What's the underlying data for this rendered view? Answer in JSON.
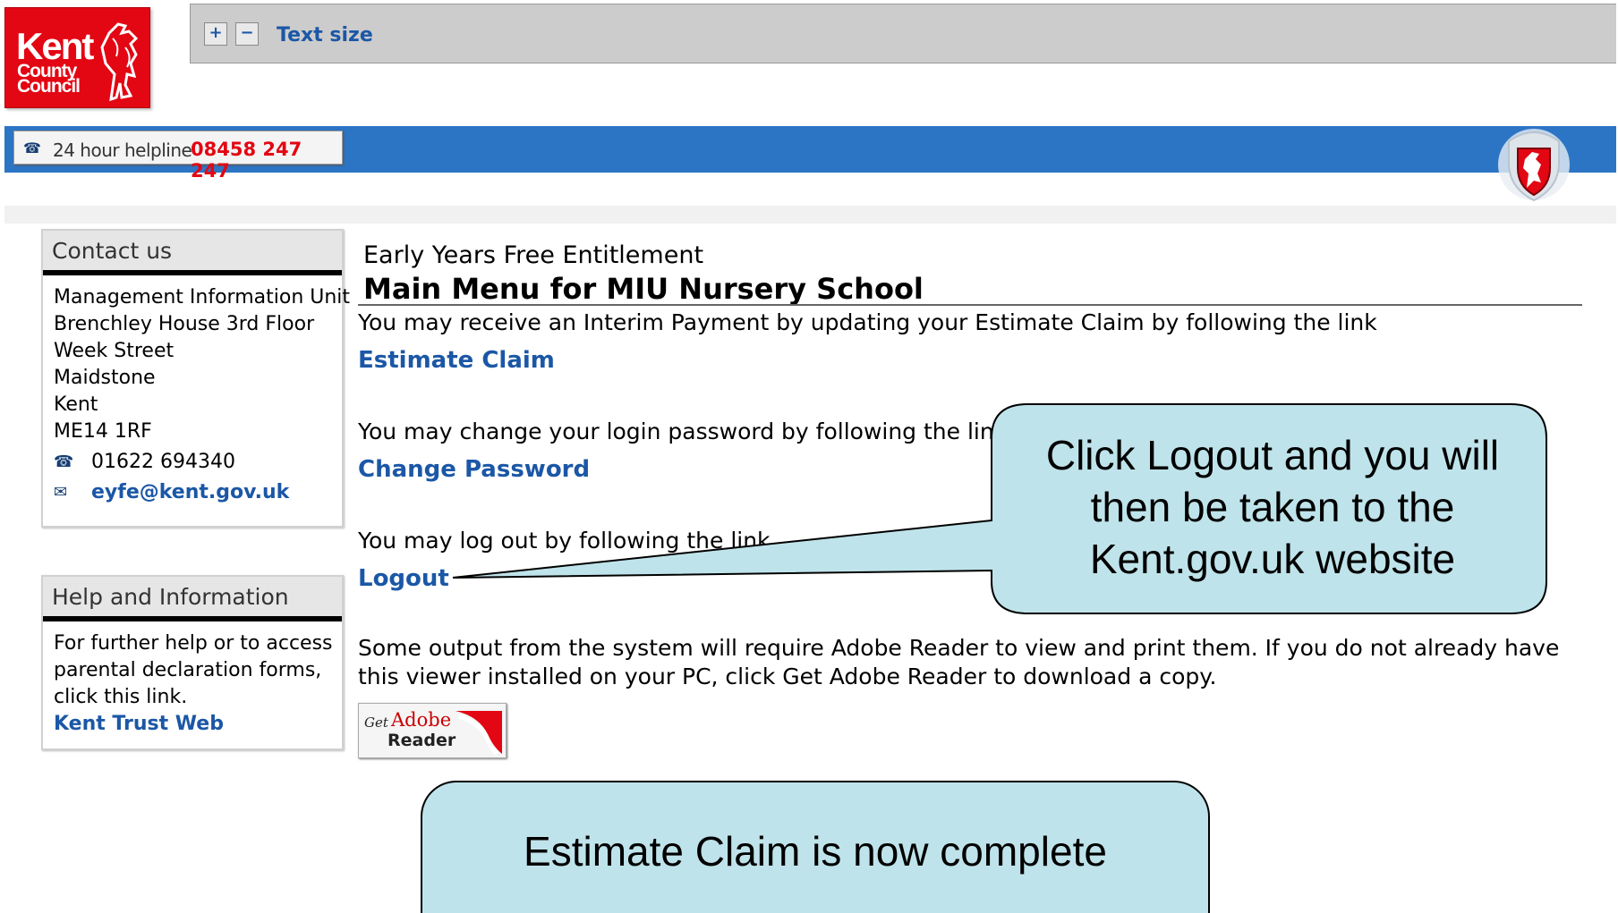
{
  "header": {
    "logo_line1": "Kent",
    "logo_line2": "County",
    "logo_line3": "Council",
    "text_size": {
      "increase_label": "+",
      "decrease_label": "−",
      "label": "Text size"
    },
    "helpline": {
      "label": "24 hour helpline",
      "number": "08458 247 247"
    }
  },
  "contact": {
    "heading": "Contact us",
    "lines": [
      "Management Information Unit",
      "Brenchley House 3rd Floor",
      "Week Street",
      "Maidstone",
      "Kent",
      "ME14 1RF"
    ],
    "phone": "01622 694340",
    "email": "eyfe@kent.gov.uk"
  },
  "help": {
    "heading": "Help and Information",
    "lines": [
      "For further help or to access",
      "parental declaration forms,",
      "click this link."
    ],
    "link_label": "Kent Trust Web"
  },
  "main": {
    "section": "Early Years Free Entitlement",
    "title": "Main Menu for MIU Nursery School",
    "estimate_text": "You may receive an Interim Payment by updating your Estimate Claim by following the link",
    "estimate_link": "Estimate Claim",
    "password_text": "You may change your login password by following the link",
    "password_link": "Change Password",
    "logout_text": "You may log out by following the link",
    "logout_link": "Logout",
    "adobe_text": "Some output from the system will require Adobe Reader to view and print them.  If you do not already have this viewer installed on your PC, click Get Adobe Reader to download a copy.",
    "adobe_get": "Get",
    "adobe_name": "Adobe",
    "adobe_reader": "Reader"
  },
  "callouts": {
    "logout_lines": [
      "Click Logout and you will",
      "then be taken to the",
      "Kent.gov.uk website"
    ],
    "complete": "Estimate Claim is now complete"
  },
  "colors": {
    "kent_red": "#e30613",
    "link_blue": "#1b57a6",
    "bar_blue": "#2c75c5",
    "callout_fill": "#bfe3ea"
  },
  "icons": [
    "kent-horse-logo-icon",
    "phone-icon",
    "email-icon",
    "kent-crest-icon",
    "adobe-reader-logo-icon"
  ]
}
